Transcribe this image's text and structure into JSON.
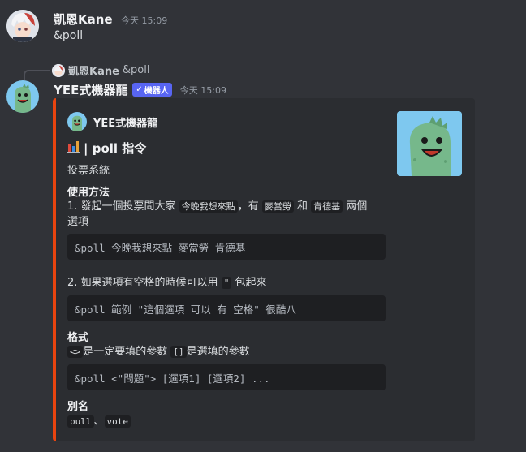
{
  "message1": {
    "username": "凱恩Kane",
    "timestamp": "今天 15:09",
    "content": "&poll"
  },
  "reply": {
    "username": "凱恩Kane",
    "content": "&poll"
  },
  "message2": {
    "username": "YEE式機器龍",
    "bot_tag": "機器人",
    "timestamp": "今天 15:09"
  },
  "embed": {
    "author": "YEE式機器龍",
    "title": "| poll 指令",
    "description": "投票系統",
    "usage_title": "使用方法",
    "step1_a": "1. 發起一個投票問大家",
    "step1_code1": "今晚我想來點",
    "step1_b": "，有",
    "step1_code2": "麥當勞",
    "step1_c": "和",
    "step1_code3": "肯德基",
    "step1_d": "兩個",
    "step1_e": "選項",
    "code1": "&poll 今晚我想來點 麥當勞 肯德基",
    "step2_a": "2. 如果選項有空格的時候可以用",
    "step2_code": "\"",
    "step2_b": "包起來",
    "code2": "&poll 範例 \"這個選項 可以 有 空格\" 很酷八",
    "format_title": "格式",
    "format_code1": "<>",
    "format_a": "是一定要填的參數",
    "format_code2": "[]",
    "format_b": "是選填的參數",
    "code3": "&poll <\"問題\"> [選項1] [選項2] ...",
    "alias_title": "別名",
    "alias_code1": "pull",
    "alias_sep": "、",
    "alias_code2": "vote",
    "accent_color": "#e8440f"
  }
}
